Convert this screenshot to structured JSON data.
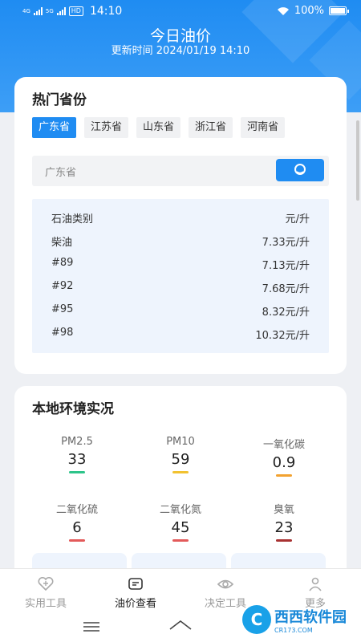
{
  "status_bar": {
    "time": "14:10",
    "battery": "100%",
    "net1": "4G",
    "net2": "5G",
    "hd": "HD"
  },
  "header": {
    "title": "今日油价",
    "update_time": "更新时间 2024/01/19 14:10"
  },
  "provinces": {
    "title": "热门省份",
    "tabs": [
      "广东省",
      "江苏省",
      "山东省",
      "浙江省",
      "河南省"
    ],
    "active_index": 0,
    "search_value": "广东省",
    "search_icon": "search-icon"
  },
  "price_table": {
    "header": {
      "type": "石油类别",
      "unit": "元/升"
    },
    "rows": [
      {
        "type": "柴油",
        "price": "7.33元/升"
      },
      {
        "type": "#89",
        "price": "7.13元/升"
      },
      {
        "type": "#92",
        "price": "7.68元/升"
      },
      {
        "type": "#95",
        "price": "8.32元/升"
      },
      {
        "type": "#98",
        "price": "10.32元/升"
      }
    ]
  },
  "environment": {
    "title": "本地环境实况",
    "items": [
      {
        "label": "PM2.5",
        "value": "33",
        "color": "#2ec48a"
      },
      {
        "label": "PM10",
        "value": "59",
        "color": "#f2c230"
      },
      {
        "label": "一氧化碳",
        "value": "0.9",
        "color": "#f2a230"
      },
      {
        "label": "二氧化硫",
        "value": "6",
        "color": "#e35a5a"
      },
      {
        "label": "二氧化氮",
        "value": "45",
        "color": "#e35a5a"
      },
      {
        "label": "臭氧",
        "value": "23",
        "color": "#a83232"
      }
    ]
  },
  "tabbar": {
    "items": [
      {
        "label": "实用工具",
        "icon": "heart-plus-icon"
      },
      {
        "label": "油价查看",
        "icon": "message-icon"
      },
      {
        "label": "决定工具",
        "icon": "eye-icon"
      },
      {
        "label": "更多",
        "icon": "person-icon"
      }
    ],
    "active_index": 1
  },
  "watermark": {
    "logo": "C",
    "text": "西西软件园",
    "sub": "CR173.COM"
  },
  "colors": {
    "accent": "#1f8cf2",
    "table_bg": "#eef4fd"
  }
}
